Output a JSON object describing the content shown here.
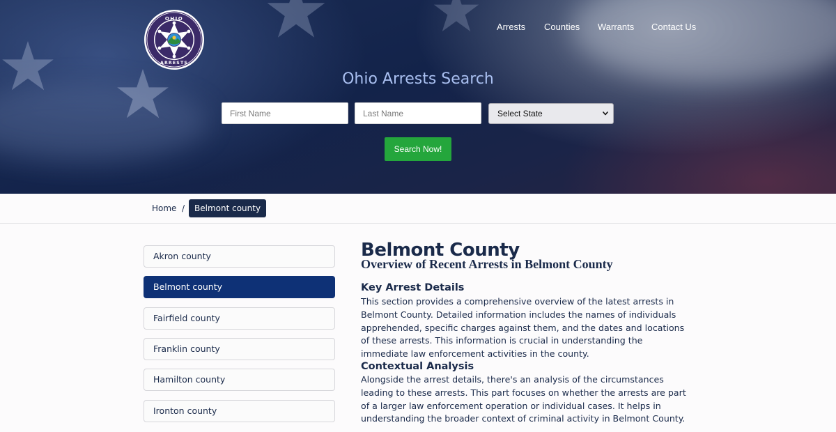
{
  "nav": {
    "items": [
      {
        "label": "Arrests"
      },
      {
        "label": "Counties"
      },
      {
        "label": "Warrants"
      },
      {
        "label": "Contact Us"
      }
    ]
  },
  "logo": {
    "top_text": "OHIO",
    "bottom_text": "ARRESTS",
    "icon": "sheriff-star-badge-icon"
  },
  "hero": {
    "title": "Ohio Arrests Search"
  },
  "search": {
    "first_placeholder": "First Name",
    "last_placeholder": "Last Name",
    "state_selected": "Select State",
    "button_label": "Search Now!"
  },
  "breadcrumb": {
    "home": "Home",
    "separator": "/",
    "current": "Belmont county"
  },
  "sidebar": {
    "counties": [
      {
        "label": "Akron county",
        "active": false
      },
      {
        "label": "Belmont county",
        "active": true
      },
      {
        "label": "Fairfield county",
        "active": false
      },
      {
        "label": "Franklin county",
        "active": false
      },
      {
        "label": "Hamilton county",
        "active": false
      },
      {
        "label": "Ironton county",
        "active": false
      }
    ]
  },
  "main": {
    "title": "Belmont County",
    "subtitle": "Overview of Recent Arrests in Belmont County",
    "sections": [
      {
        "heading": "Key Arrest Details",
        "body": "This section provides a comprehensive overview of the latest arrests in Belmont County. Detailed information includes the names of individuals apprehended, specific charges against them, and the dates and locations of these arrests. This information is crucial in understanding the immediate law enforcement activities in the county."
      },
      {
        "heading": "Contextual Analysis",
        "body": "Alongside the arrest details, there's an analysis of the circumstances leading to these arrests. This part focuses on whether the arrests are part of a larger law enforcement operation or individual cases. It helps in understanding the broader context of criminal activity in Belmont County."
      }
    ]
  },
  "colors": {
    "accent_green": "#24a63c",
    "navy": "#1a2a4a",
    "active_blue": "#0e3176",
    "hero_title": "#a9bff0"
  }
}
